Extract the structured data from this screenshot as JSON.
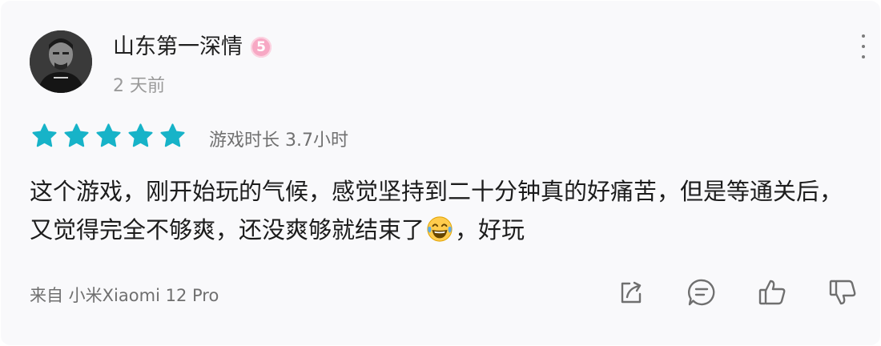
{
  "comment": {
    "username": "山东第一深情",
    "level_badge": "5",
    "time_ago": "2 天前",
    "rating_stars": 5,
    "star_color": "#17b3c8",
    "playtime": "游戏时长 3.7小时",
    "text_before_emoji": "这个游戏，刚开始玩的气候，感觉坚持到二十分钟真的好痛苦，但是等通关后，又觉得完全不够爽，还没爽够就结束了",
    "emoji": "laughing-with-tears-emoji",
    "text_after_emoji": "，好玩",
    "device": "来自 小米Xiaomi 12 Pro"
  },
  "actions": {
    "share_icon": "share-icon",
    "reply_icon": "comment-icon",
    "like_icon": "thumbs-up-icon",
    "dislike_icon": "thumbs-down-icon"
  },
  "colors": {
    "card_bg": "#f9f9fb",
    "accent": "#17b3c8",
    "badge": "#f7a8c4"
  }
}
